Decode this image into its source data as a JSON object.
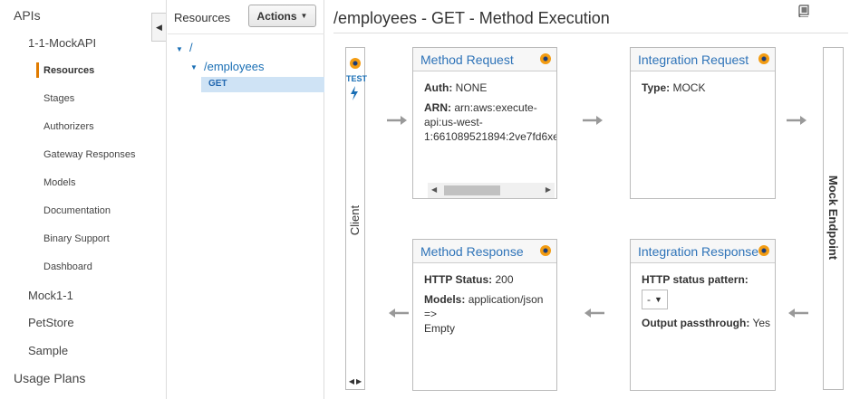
{
  "sidebar": {
    "items": [
      {
        "label": "APIs"
      },
      {
        "label": "1-1-MockAPI"
      },
      {
        "label": "Resources"
      },
      {
        "label": "Stages"
      },
      {
        "label": "Authorizers"
      },
      {
        "label": "Gateway Responses"
      },
      {
        "label": "Models"
      },
      {
        "label": "Documentation"
      },
      {
        "label": "Binary Support"
      },
      {
        "label": "Dashboard"
      },
      {
        "label": "Mock1-1"
      },
      {
        "label": "PetStore"
      },
      {
        "label": "Sample"
      },
      {
        "label": "Usage Plans"
      }
    ],
    "active_accent": "#e07b00"
  },
  "resources": {
    "title": "Resources",
    "actions_label": "Actions",
    "tree": {
      "root": "/",
      "child": "/employees",
      "method": "GET"
    }
  },
  "main": {
    "title": "/employees - GET - Method Execution",
    "client": {
      "label": "Client",
      "test_label": "TEST"
    },
    "method_request": {
      "title": "Method Request",
      "auth_key": "Auth:",
      "auth_val": "NONE",
      "arn_key": "ARN:",
      "arn_line1": "arn:aws:execute-",
      "arn_line2": "api:us-west-",
      "arn_line3": "1:661089521894:2ve7fd6xe"
    },
    "integration_request": {
      "title": "Integration Request",
      "type_key": "Type:",
      "type_val": "MOCK"
    },
    "method_response": {
      "title": "Method Response",
      "status_key": "HTTP Status:",
      "status_val": "200",
      "models_key": "Models:",
      "models_val": "application/json =>",
      "models_val2": "Empty"
    },
    "integration_response": {
      "title": "Integration Response",
      "pattern_key": "HTTP status pattern:",
      "pattern_val": "-",
      "passthrough_key": "Output passthrough:",
      "passthrough_val": "Yes"
    },
    "mock_endpoint": {
      "label": "Mock Endpoint"
    }
  },
  "colors": {
    "link": "#2e73b8",
    "selected_row": "#cfe3f5",
    "dot": "#f39c12"
  }
}
